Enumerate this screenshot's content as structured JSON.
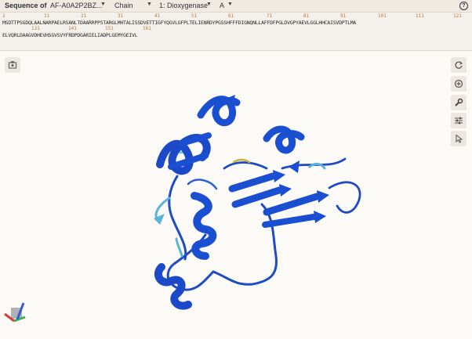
{
  "header": {
    "label": "Sequence of",
    "entry": "AF-A0A2P2BZ...",
    "mode": "Chain",
    "chain": "1: Dioxygenase",
    "chain_id": "A",
    "help": "?"
  },
  "sequence": {
    "line1": "MSDTTPSGDQLAALNARPAELRSANLTDAARRPPSTARGLMHTALISSDVETTIGFYQGVLGFPLTELIENRDYPGSSHFFFDIGNQNLLAFFDFPGLDVGPYAEVLGGLHHCAISVDPTLMA",
    "line2": "ELVQRLDAAGVDHEVHSGVSVYFRDPDGARIELIADPLGEMYGEIVL",
    "numbers_line1": [
      "1",
      "11",
      "21",
      "31",
      "41",
      "51",
      "61",
      "71",
      "81",
      "91",
      "101",
      "111",
      "121"
    ],
    "numbers_line2": [
      "131",
      "141",
      "151",
      "161"
    ]
  },
  "colors": {
    "helix": "#1a4fd1",
    "loop": "#1f4fc6",
    "low_confidence": "#57b4d9",
    "bond": "#c9b23a"
  },
  "icons": [
    "screenshot-icon",
    "reset-icon",
    "focus-icon",
    "wrench-icon",
    "sliders-icon",
    "pointer-icon"
  ]
}
